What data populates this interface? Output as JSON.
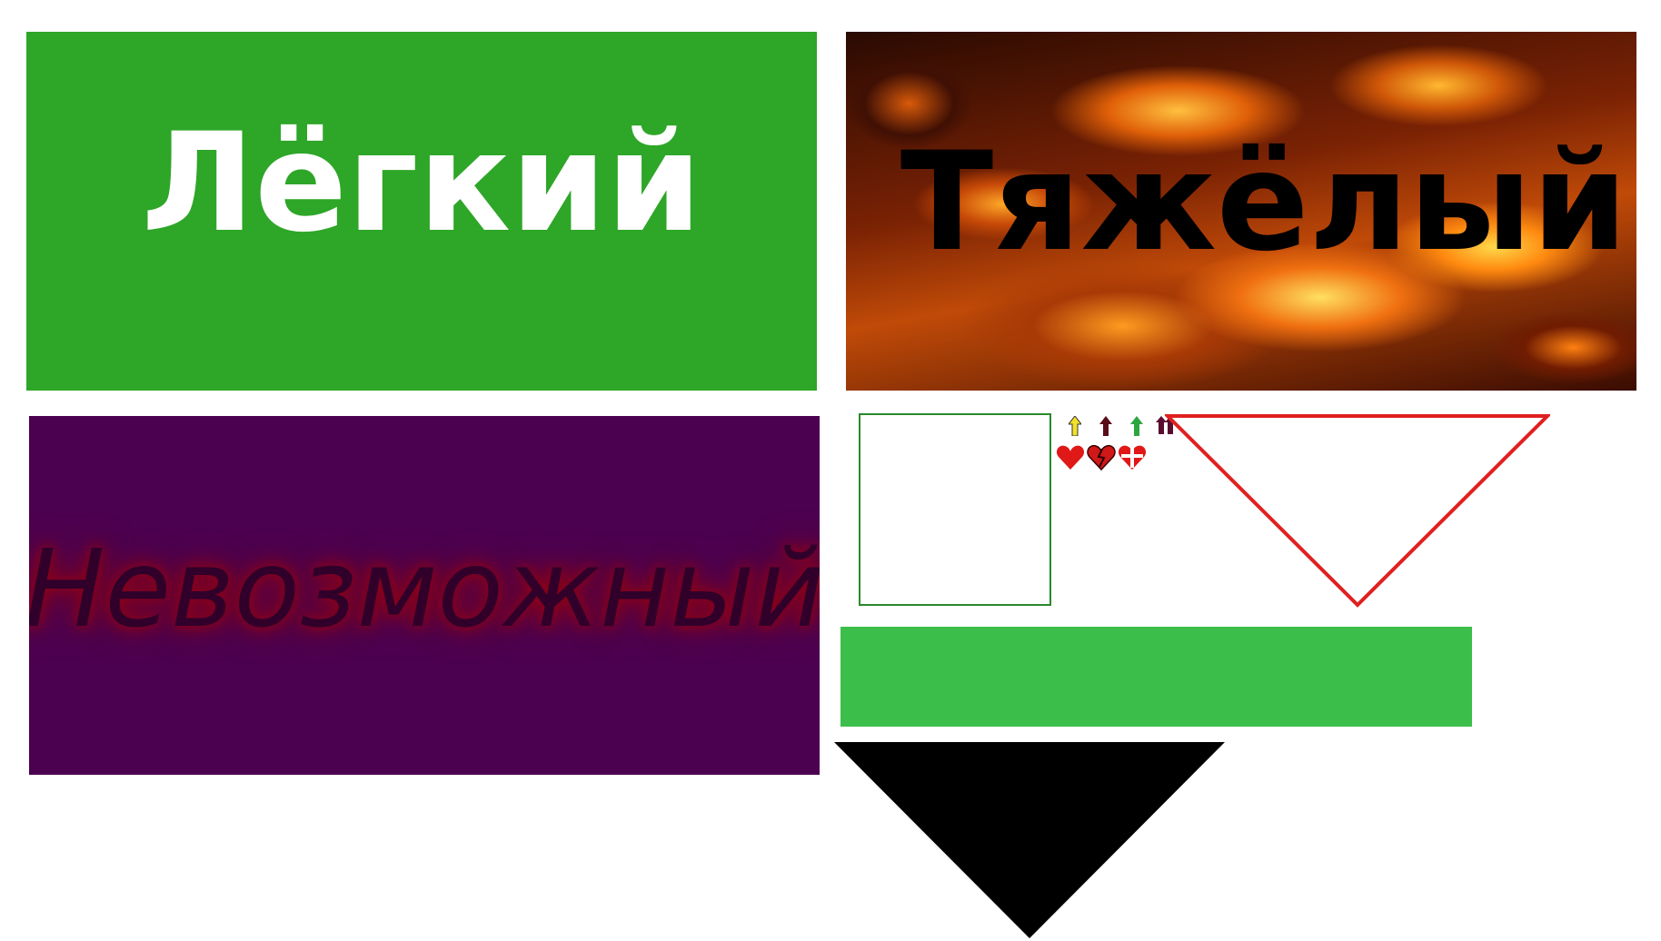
{
  "difficulty": {
    "easy": {
      "label": "Лёгкий",
      "color": "#2ea628"
    },
    "hard": {
      "label": "Тяжёлый"
    },
    "impossible": {
      "label": "Невозможный",
      "color": "#4c0050"
    }
  },
  "status_icons": {
    "arrows": [
      "arrow-up-yellow-icon",
      "arrow-up-darkred-icon",
      "arrow-up-green-icon",
      "double-arrow-icon"
    ],
    "hearts": [
      "heart-icon",
      "broken-heart-icon",
      "plus-heart-icon"
    ]
  },
  "shapes": {
    "panel_border_color": "#2a8a2a",
    "outline_triangle_color": "#e02020",
    "bar_color": "#3cbf4a",
    "solid_triangle_color": "#000000"
  }
}
